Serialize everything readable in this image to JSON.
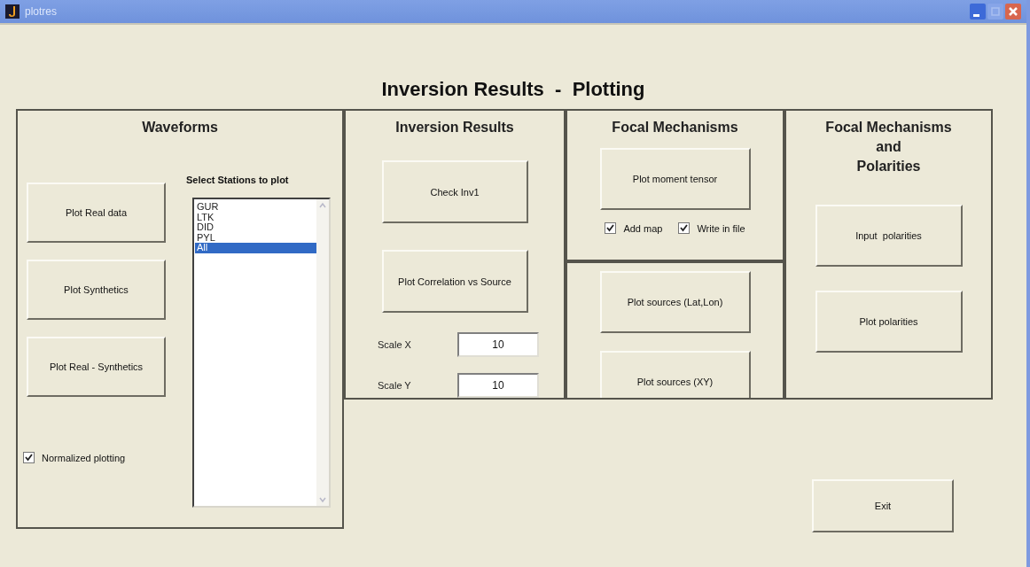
{
  "window": {
    "title": "plotres"
  },
  "heading": "Inversion Results  -  Plotting",
  "waveforms": {
    "title": "Waveforms",
    "buttons": [
      "Plot Real data",
      "Plot Synthetics",
      "Plot Real - Synthetics"
    ],
    "normalized": {
      "label": "Normalized plotting",
      "checked": true
    },
    "stations_label": "Select Stations to plot",
    "stations": [
      {
        "label": "GUR",
        "selected": false
      },
      {
        "label": "LTK",
        "selected": false
      },
      {
        "label": "DID",
        "selected": false
      },
      {
        "label": "PYL",
        "selected": false
      },
      {
        "label": "All",
        "selected": true
      }
    ]
  },
  "inversion": {
    "title": "Inversion Results",
    "buttons": [
      "Check Inv1",
      "Plot Correlation vs Source"
    ],
    "scales": [
      {
        "label": "Scale X",
        "value": "10"
      },
      {
        "label": "Scale Y",
        "value": "10"
      }
    ]
  },
  "focal": {
    "title": "Focal Mechanisms",
    "button": "Plot moment tensor",
    "options": [
      {
        "label": "Add map",
        "checked": true
      },
      {
        "label": "Write in file",
        "checked": true
      }
    ]
  },
  "sources": {
    "buttons": [
      "Plot sources (Lat,Lon)",
      "Plot sources (XY)"
    ]
  },
  "polarities": {
    "title": "Focal Mechanisms\nand\nPolarities",
    "buttons": [
      "Input  polarities",
      "Plot polarities"
    ]
  },
  "exit": "Exit"
}
